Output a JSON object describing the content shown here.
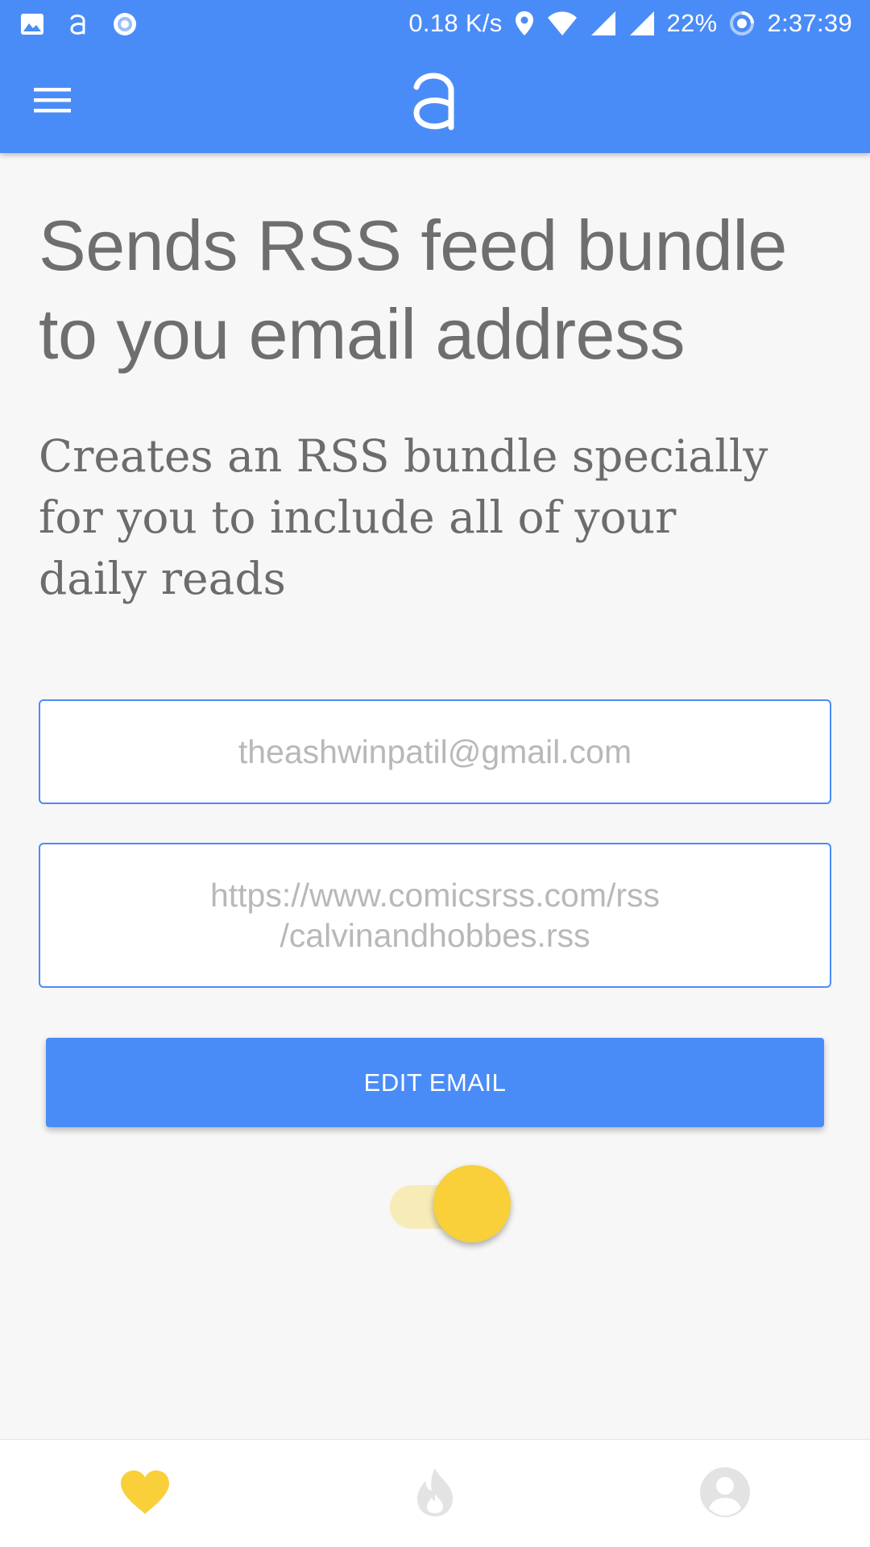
{
  "status_bar": {
    "network_speed": "0.18 K/s",
    "battery": "22%",
    "time": "2:37:39",
    "left_icons": [
      "image-icon",
      "app-logo-icon",
      "circle-notification-icon"
    ],
    "right_icons": [
      "location-icon",
      "wifi-icon",
      "signal-icon",
      "signal-icon",
      "battery-saver-icon"
    ]
  },
  "app_bar": {
    "menu_icon": "hamburger-menu-icon",
    "logo_icon": "app-logo-icon"
  },
  "main": {
    "headline": "Sends RSS feed bundle to you email address",
    "subheadline": "Creates an RSS bundle specially for you to include all of your daily reads",
    "email_field": {
      "placeholder": "theashwinpatil@gmail.com"
    },
    "rss_field": {
      "placeholder_line1": "https://www.comicsrss.com/rss",
      "placeholder_line2": "/calvinandhobbes.rss"
    },
    "edit_button": "EDIT EMAIL",
    "toggle": {
      "on": true
    }
  },
  "bottom_nav": {
    "items": [
      {
        "icon": "heart-icon",
        "active": true
      },
      {
        "icon": "flame-icon",
        "active": false
      },
      {
        "icon": "profile-icon",
        "active": false
      }
    ]
  },
  "colors": {
    "primary": "#4a8cf7",
    "accent": "#f9cf3a",
    "background": "#f7f7f7",
    "text_gray": "#6e6e6e",
    "placeholder_gray": "#b8b8b8",
    "inactive_icon": "#e3e3e3"
  }
}
